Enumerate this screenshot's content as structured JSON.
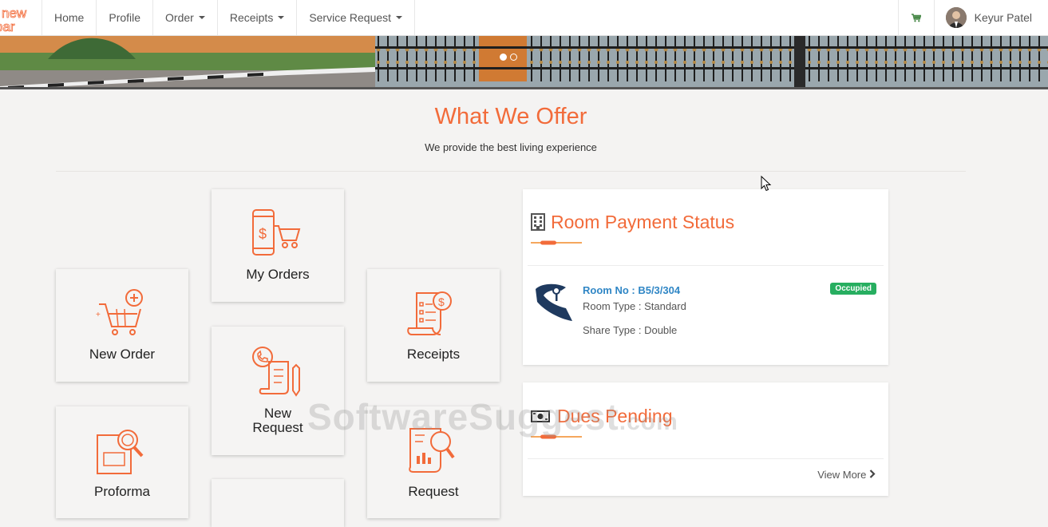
{
  "nav": {
    "logo_text": [
      "new",
      "bar"
    ],
    "items": [
      {
        "label": "Home",
        "dropdown": false
      },
      {
        "label": "Profile",
        "dropdown": false
      },
      {
        "label": "Order",
        "dropdown": true
      },
      {
        "label": "Receipts",
        "dropdown": true
      },
      {
        "label": "Service Request",
        "dropdown": true
      }
    ],
    "cart_icon": "cart-icon",
    "user_name": "Keyur Patel"
  },
  "hero": {
    "slides": 2,
    "active_slide": 1
  },
  "offer": {
    "title": "What We Offer",
    "subtitle": "We provide the best living experience"
  },
  "tiles": {
    "my_orders": "My Orders",
    "new_order": "New Order",
    "receipts": "Receipts",
    "new_request_line1": "New",
    "new_request_line2": "Request",
    "proforma": "Proforma",
    "request": "Request"
  },
  "room_card": {
    "title": "Room Payment Status",
    "room_no": "Room No : B5/3/304",
    "room_type": "Room Type : Standard",
    "share_type": "Share Type : Double",
    "status": "Occupied"
  },
  "dues_card": {
    "title": "Dues Pending",
    "view_more": "View More"
  },
  "watermark": {
    "text": "SoftwareSuggest",
    "suffix": ".com"
  },
  "colors": {
    "accent": "#f26b3a",
    "link": "#2f86c5",
    "badge": "#27ae60"
  }
}
